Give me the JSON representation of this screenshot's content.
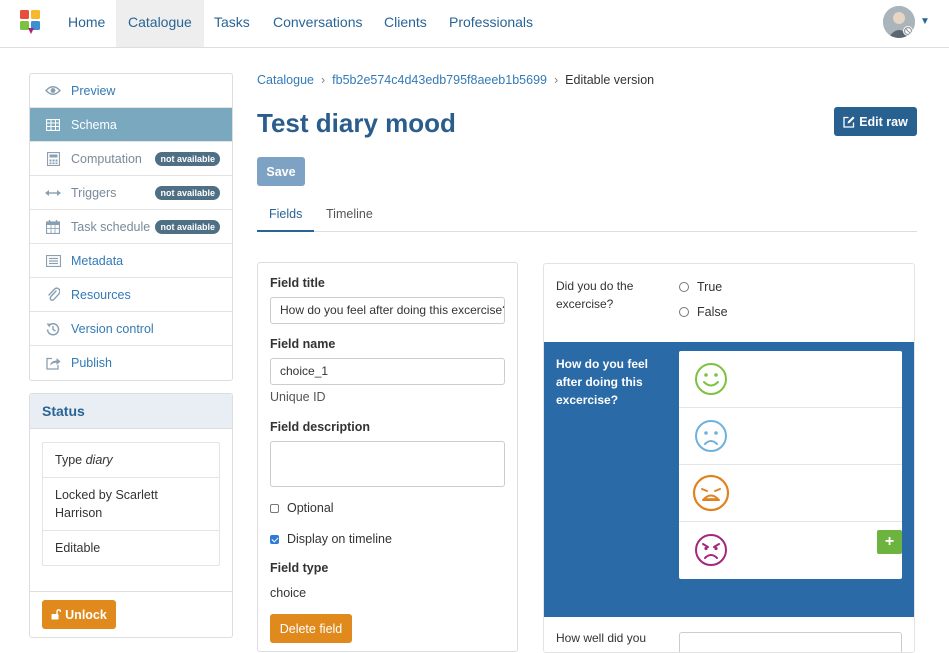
{
  "nav": {
    "items": [
      {
        "label": "Home",
        "active": false
      },
      {
        "label": "Catalogue",
        "active": true
      },
      {
        "label": "Tasks",
        "active": false
      },
      {
        "label": "Conversations",
        "active": false
      },
      {
        "label": "Clients",
        "active": false
      },
      {
        "label": "Professionals",
        "active": false
      }
    ]
  },
  "sidebar": {
    "items": [
      {
        "label": "Preview",
        "icon": "eye-icon",
        "active": false,
        "badge": ""
      },
      {
        "label": "Schema",
        "icon": "table-icon",
        "active": true,
        "badge": ""
      },
      {
        "label": "Computation",
        "icon": "calculator-icon",
        "active": false,
        "badge": "not available"
      },
      {
        "label": "Triggers",
        "icon": "arrows-h-icon",
        "active": false,
        "badge": "not available"
      },
      {
        "label": "Task schedule",
        "icon": "calendar-icon",
        "active": false,
        "badge": "not available"
      },
      {
        "label": "Metadata",
        "icon": "list-alt-icon",
        "active": false,
        "badge": ""
      },
      {
        "label": "Resources",
        "icon": "paperclip-icon",
        "active": false,
        "badge": ""
      },
      {
        "label": "Version control",
        "icon": "history-icon",
        "active": false,
        "badge": ""
      },
      {
        "label": "Publish",
        "icon": "share-icon",
        "active": false,
        "badge": ""
      }
    ]
  },
  "status": {
    "title": "Status",
    "type_prefix": "Type",
    "type_value": "diary",
    "locked_by": "Locked by Scarlett Harrison",
    "editable": "Editable",
    "unlock_label": "Unlock"
  },
  "breadcrumb": {
    "root": "Catalogue",
    "id": "fb5b2e574c4d43edb795f8aeeb1b5699",
    "current": "Editable version"
  },
  "page": {
    "title": "Test diary mood",
    "edit_raw_label": "Edit raw",
    "save_label": "Save"
  },
  "tabs": [
    {
      "label": "Fields",
      "active": true
    },
    {
      "label": "Timeline",
      "active": false
    }
  ],
  "field_editor": {
    "title_label": "Field title",
    "title_value": "How do you feel after doing this excercise?",
    "name_label": "Field name",
    "name_value": "choice_1",
    "name_help": "Unique ID",
    "description_label": "Field description",
    "description_value": "",
    "optional_label": "Optional",
    "optional_checked": false,
    "timeline_label": "Display on timeline",
    "timeline_checked": true,
    "type_label": "Field type",
    "type_value": "choice",
    "delete_label": "Delete field"
  },
  "preview": {
    "q1_label": "Did you do the excercise?",
    "q1_options": [
      "True",
      "False"
    ],
    "q2_label": "How do you feel after doing this excercise?",
    "q2_moods": [
      {
        "icon": "smile-icon",
        "color": "#7cc242"
      },
      {
        "icon": "sad-icon",
        "color": "#6fb1de"
      },
      {
        "icon": "angry-icon",
        "color": "#e0821f"
      },
      {
        "icon": "furious-icon",
        "color": "#a3277a"
      }
    ],
    "add_label": "+",
    "q3_label": "How well did you"
  },
  "colors": {
    "brand_blue": "#2a6496",
    "active_side": "#79a8bf",
    "orange": "#e08a1e",
    "preview_blue": "#2a6aa6",
    "green": "#6db33f"
  }
}
